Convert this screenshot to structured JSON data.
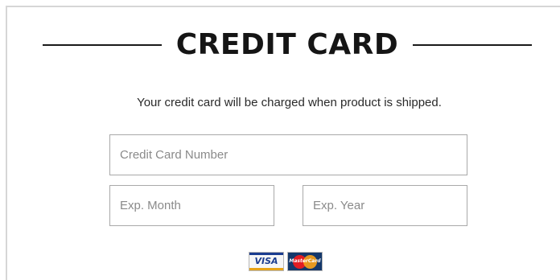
{
  "section": {
    "title": "CREDIT CARD",
    "notice": "Your credit card will be charged when product is shipped."
  },
  "form": {
    "card_number_placeholder": "Credit Card Number",
    "exp_month_placeholder": "Exp. Month",
    "exp_year_placeholder": "Exp. Year"
  },
  "accepted_cards": {
    "visa_label": "VISA",
    "mastercard_label": "MasterCard"
  },
  "colors": {
    "title": "#151515",
    "border": "#a9a9a9",
    "visa_blue": "#1a3c8f",
    "visa_gold": "#e8a317",
    "mc_red": "#e21d24",
    "mc_yellow": "#f7a21b"
  }
}
